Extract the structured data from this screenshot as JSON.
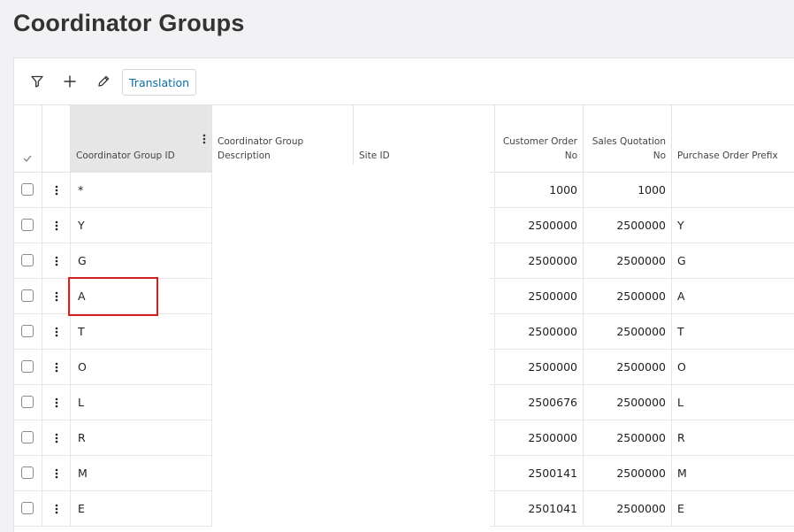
{
  "page": {
    "title": "Coordinator Groups"
  },
  "toolbar": {
    "filter_icon": "filter-icon",
    "add_icon": "plus-icon",
    "edit_icon": "pencil-icon",
    "translation_label": "Translation"
  },
  "columns": {
    "select_all_icon": "check-icon",
    "coordinator_group_id": "Coordinator Group ID",
    "coordinator_group_description": "Coordinator Group Description",
    "site_id": "Site ID",
    "customer_order_no_line1": "Customer Order",
    "customer_order_no_line2": "No",
    "sales_quotation_no_line1": "Sales Quotation",
    "sales_quotation_no_line2": "No",
    "purchase_order_prefix": "Purchase Order Prefix"
  },
  "rows": [
    {
      "id": "*",
      "customer_order_no": "1000",
      "sales_quotation_no": "1000",
      "purchase_order_prefix": ""
    },
    {
      "id": "Y",
      "customer_order_no": "2500000",
      "sales_quotation_no": "2500000",
      "purchase_order_prefix": "Y"
    },
    {
      "id": "G",
      "customer_order_no": "2500000",
      "sales_quotation_no": "2500000",
      "purchase_order_prefix": "G"
    },
    {
      "id": "A",
      "customer_order_no": "2500000",
      "sales_quotation_no": "2500000",
      "purchase_order_prefix": "A"
    },
    {
      "id": "T",
      "customer_order_no": "2500000",
      "sales_quotation_no": "2500000",
      "purchase_order_prefix": "T"
    },
    {
      "id": "O",
      "customer_order_no": "2500000",
      "sales_quotation_no": "2500000",
      "purchase_order_prefix": "O"
    },
    {
      "id": "L",
      "customer_order_no": "2500676",
      "sales_quotation_no": "2500000",
      "purchase_order_prefix": "L"
    },
    {
      "id": "R",
      "customer_order_no": "2500000",
      "sales_quotation_no": "2500000",
      "purchase_order_prefix": "R"
    },
    {
      "id": "M",
      "customer_order_no": "2500141",
      "sales_quotation_no": "2500000",
      "purchase_order_prefix": "M"
    },
    {
      "id": "E",
      "customer_order_no": "2501041",
      "sales_quotation_no": "2500000",
      "purchase_order_prefix": "E"
    }
  ],
  "colors": {
    "accent": "#0b6fa4",
    "highlight": "#d61f1f",
    "active_header": "#e6e6e6"
  }
}
